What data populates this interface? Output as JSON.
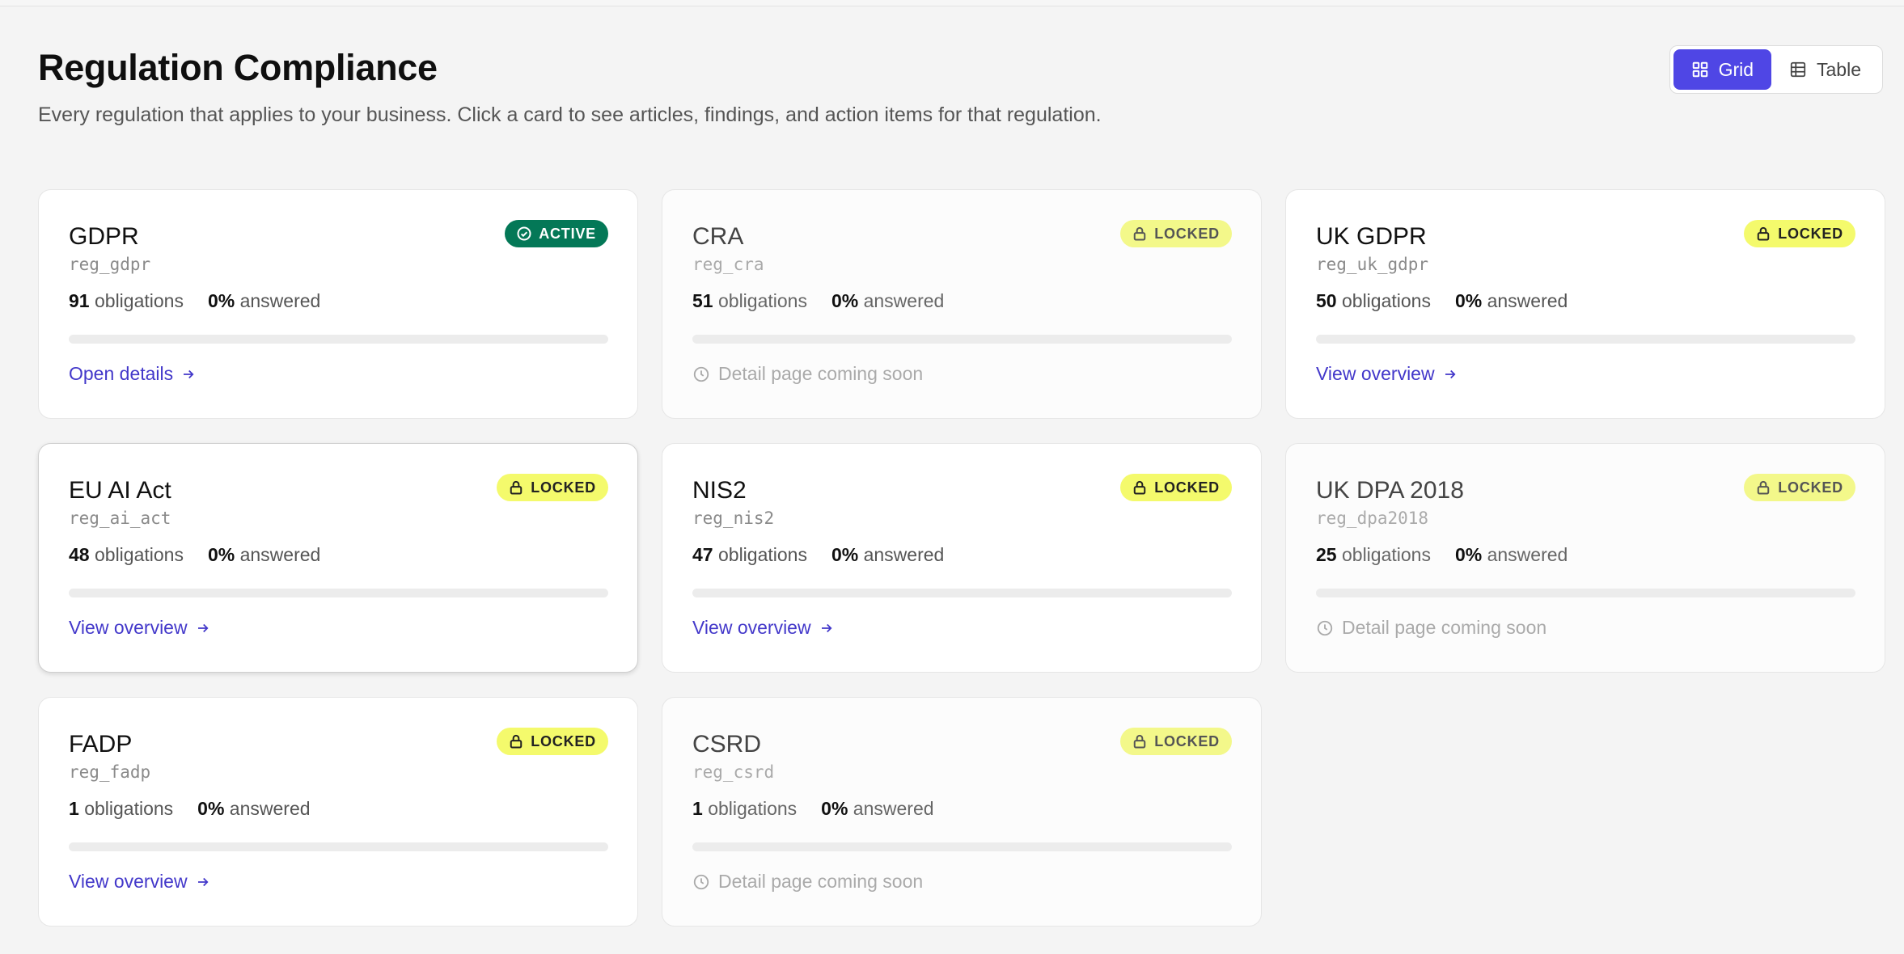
{
  "header": {
    "title": "Regulation Compliance",
    "subtitle": "Every regulation that applies to your business. Click a card to see articles, findings, and action items for that regulation."
  },
  "view_toggle": {
    "grid_label": "Grid",
    "table_label": "Table",
    "selected": "grid"
  },
  "colors": {
    "accent": "#4f46e5",
    "active_badge": "#047857",
    "locked_badge": "#f4fa6c",
    "link": "#4338ca"
  },
  "labels": {
    "obligations": "obligations",
    "answered": "answered"
  },
  "regulations": [
    {
      "title": "GDPR",
      "code": "reg_gdpr",
      "obligations": "91",
      "answered": "0%",
      "progress": 0,
      "badge": "ACTIVE",
      "status": "active",
      "link": "Open details",
      "soon": null,
      "muted": false,
      "highlight": false
    },
    {
      "title": "CRA",
      "code": "reg_cra",
      "obligations": "51",
      "answered": "0%",
      "progress": 0,
      "badge": "LOCKED",
      "status": "locked",
      "link": null,
      "soon": "Detail page coming soon",
      "muted": true,
      "highlight": false
    },
    {
      "title": "UK GDPR",
      "code": "reg_uk_gdpr",
      "obligations": "50",
      "answered": "0%",
      "progress": 0,
      "badge": "LOCKED",
      "status": "locked",
      "link": "View overview",
      "soon": null,
      "muted": false,
      "highlight": false
    },
    {
      "title": "EU AI Act",
      "code": "reg_ai_act",
      "obligations": "48",
      "answered": "0%",
      "progress": 0,
      "badge": "LOCKED",
      "status": "locked",
      "link": "View overview",
      "soon": null,
      "muted": false,
      "highlight": true
    },
    {
      "title": "NIS2",
      "code": "reg_nis2",
      "obligations": "47",
      "answered": "0%",
      "progress": 0,
      "badge": "LOCKED",
      "status": "locked",
      "link": "View overview",
      "soon": null,
      "muted": false,
      "highlight": false
    },
    {
      "title": "UK DPA 2018",
      "code": "reg_dpa2018",
      "obligations": "25",
      "answered": "0%",
      "progress": 0,
      "badge": "LOCKED",
      "status": "locked",
      "link": null,
      "soon": "Detail page coming soon",
      "muted": true,
      "highlight": false
    },
    {
      "title": "FADP",
      "code": "reg_fadp",
      "obligations": "1",
      "answered": "0%",
      "progress": 0,
      "badge": "LOCKED",
      "status": "locked",
      "link": "View overview",
      "soon": null,
      "muted": false,
      "highlight": false
    },
    {
      "title": "CSRD",
      "code": "reg_csrd",
      "obligations": "1",
      "answered": "0%",
      "progress": 0,
      "badge": "LOCKED",
      "status": "locked",
      "link": null,
      "soon": "Detail page coming soon",
      "muted": true,
      "highlight": false
    }
  ]
}
